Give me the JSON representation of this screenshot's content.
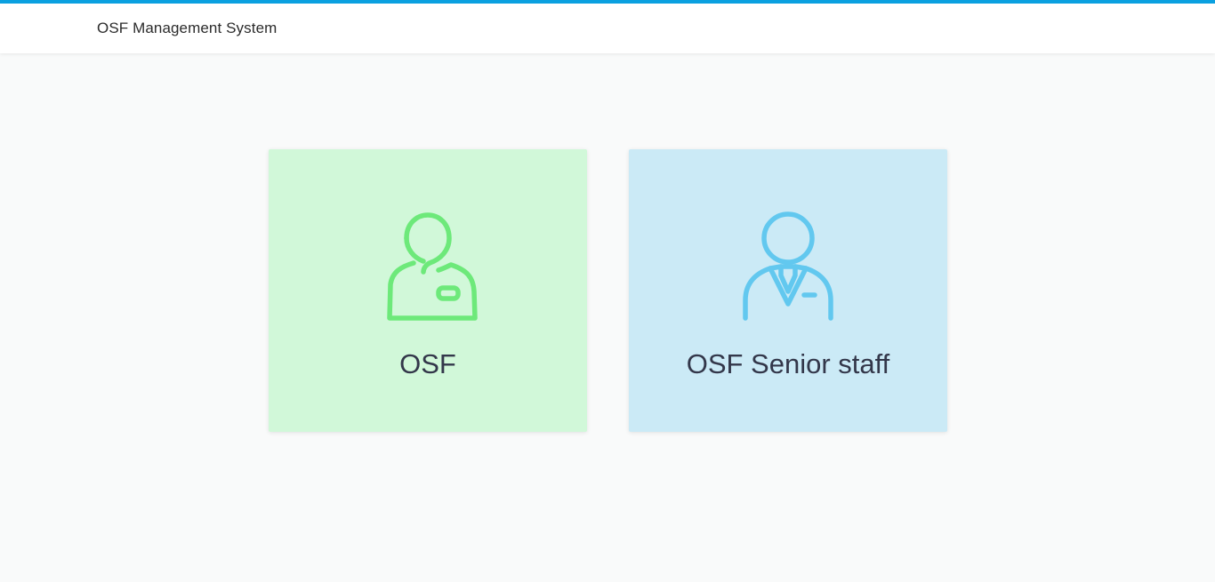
{
  "header": {
    "title": "OSF Management System",
    "accent_color": "#0aa0e0"
  },
  "roles": [
    {
      "label": "OSF",
      "icon": "user-icon",
      "background": "#d1f8d9",
      "icon_color": "#6de97a"
    },
    {
      "label": "OSF Senior staff",
      "icon": "staff-icon",
      "background": "#cbeaf6",
      "icon_color": "#62c8ef"
    }
  ]
}
